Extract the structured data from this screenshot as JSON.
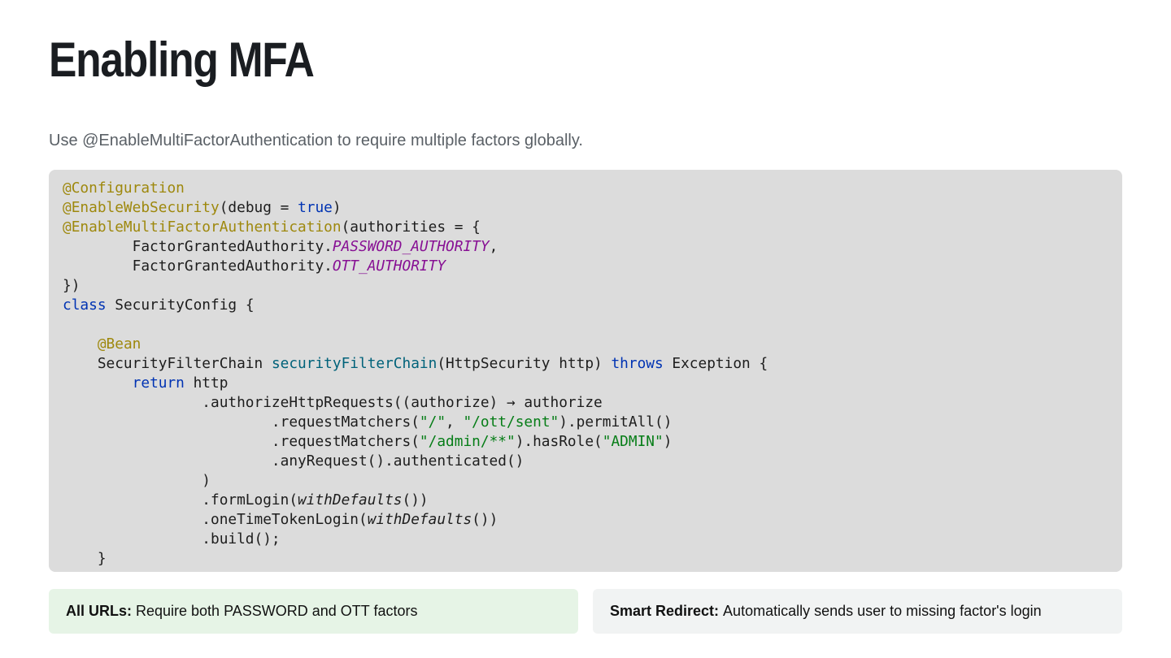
{
  "page": {
    "title": "Enabling MFA",
    "subtitle": "Use @EnableMultiFactorAuthentication to require multiple factors globally."
  },
  "code": {
    "language": "java",
    "lines": [
      [
        {
          "t": "@Configuration",
          "c": "ann"
        }
      ],
      [
        {
          "t": "@EnableWebSecurity",
          "c": "ann"
        },
        {
          "t": "(debug = "
        },
        {
          "t": "true",
          "c": "kw"
        },
        {
          "t": ")"
        }
      ],
      [
        {
          "t": "@EnableMultiFactorAuthentication",
          "c": "ann"
        },
        {
          "t": "(authorities = {"
        }
      ],
      [
        {
          "t": "        FactorGrantedAuthority."
        },
        {
          "t": "PASSWORD_AUTHORITY",
          "c": "fld"
        },
        {
          "t": ","
        }
      ],
      [
        {
          "t": "        FactorGrantedAuthority."
        },
        {
          "t": "OTT_AUTHORITY",
          "c": "fld"
        }
      ],
      [
        {
          "t": "})"
        }
      ],
      [
        {
          "t": "class",
          "c": "kw"
        },
        {
          "t": " SecurityConfig {"
        }
      ],
      [],
      [
        {
          "t": "    "
        },
        {
          "t": "@Bean",
          "c": "ann"
        }
      ],
      [
        {
          "t": "    SecurityFilterChain "
        },
        {
          "t": "securityFilterChain",
          "c": "mth"
        },
        {
          "t": "(HttpSecurity http) "
        },
        {
          "t": "throws",
          "c": "kw"
        },
        {
          "t": " Exception {"
        }
      ],
      [
        {
          "t": "        "
        },
        {
          "t": "return",
          "c": "kw"
        },
        {
          "t": " http"
        }
      ],
      [
        {
          "t": "                .authorizeHttpRequests((authorize) → authorize"
        }
      ],
      [
        {
          "t": "                        .requestMatchers("
        },
        {
          "t": "\"/\"",
          "c": "str"
        },
        {
          "t": ", "
        },
        {
          "t": "\"/ott/sent\"",
          "c": "str"
        },
        {
          "t": ").permitAll()"
        }
      ],
      [
        {
          "t": "                        .requestMatchers("
        },
        {
          "t": "\"/admin/**\"",
          "c": "str"
        },
        {
          "t": ").hasRole("
        },
        {
          "t": "\"ADMIN\"",
          "c": "str"
        },
        {
          "t": ")"
        }
      ],
      [
        {
          "t": "                        .anyRequest().authenticated()"
        }
      ],
      [
        {
          "t": "                )"
        }
      ],
      [
        {
          "t": "                .formLogin("
        },
        {
          "t": "withDefaults",
          "c": "it"
        },
        {
          "t": "())"
        }
      ],
      [
        {
          "t": "                .oneTimeTokenLogin("
        },
        {
          "t": "withDefaults",
          "c": "it"
        },
        {
          "t": "())"
        }
      ],
      [
        {
          "t": "                .build();"
        }
      ],
      [
        {
          "t": "    }"
        }
      ]
    ],
    "colors": {
      "background": "#dcdcdc",
      "annotation": "#9e880d",
      "keyword": "#0033b3",
      "field": "#871094",
      "method": "#00627a",
      "string": "#067d17"
    }
  },
  "cards": [
    {
      "label": "All URLs:",
      "text": "Require both PASSWORD and OTT factors",
      "color": "#e6f4e6"
    },
    {
      "label": "Smart Redirect:",
      "text": "Automatically sends user to missing factor's login",
      "color": "#f1f3f3"
    }
  ]
}
